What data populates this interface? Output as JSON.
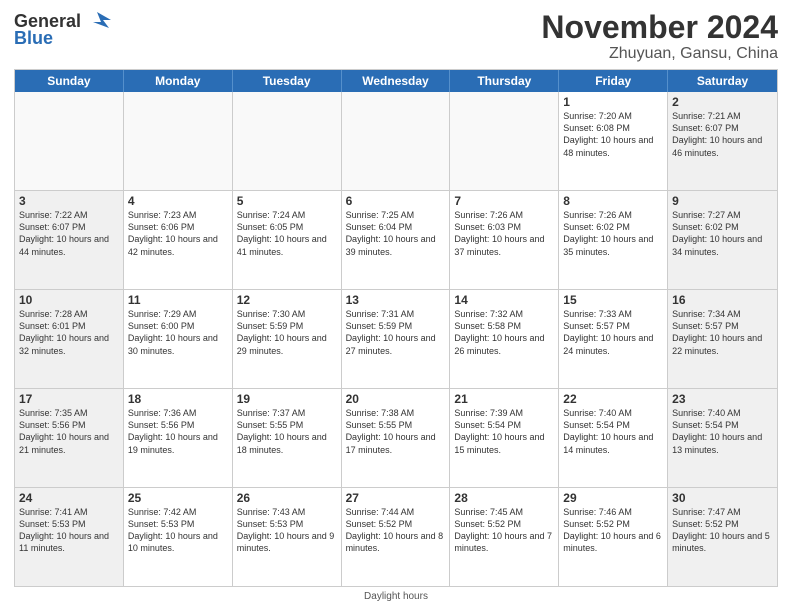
{
  "header": {
    "logo_general": "General",
    "logo_blue": "Blue",
    "month_title": "November 2024",
    "location": "Zhuyuan, Gansu, China"
  },
  "weekdays": [
    "Sunday",
    "Monday",
    "Tuesday",
    "Wednesday",
    "Thursday",
    "Friday",
    "Saturday"
  ],
  "footer": "Daylight hours",
  "weeks": [
    [
      {
        "day": "",
        "info": "",
        "empty": true
      },
      {
        "day": "",
        "info": "",
        "empty": true
      },
      {
        "day": "",
        "info": "",
        "empty": true
      },
      {
        "day": "",
        "info": "",
        "empty": true
      },
      {
        "day": "",
        "info": "",
        "empty": true
      },
      {
        "day": "1",
        "info": "Sunrise: 7:20 AM\nSunset: 6:08 PM\nDaylight: 10 hours\nand 48 minutes.",
        "empty": false
      },
      {
        "day": "2",
        "info": "Sunrise: 7:21 AM\nSunset: 6:07 PM\nDaylight: 10 hours\nand 46 minutes.",
        "empty": false,
        "shaded": true
      }
    ],
    [
      {
        "day": "3",
        "info": "Sunrise: 7:22 AM\nSunset: 6:07 PM\nDaylight: 10 hours\nand 44 minutes.",
        "empty": false,
        "shaded": true
      },
      {
        "day": "4",
        "info": "Sunrise: 7:23 AM\nSunset: 6:06 PM\nDaylight: 10 hours\nand 42 minutes.",
        "empty": false
      },
      {
        "day": "5",
        "info": "Sunrise: 7:24 AM\nSunset: 6:05 PM\nDaylight: 10 hours\nand 41 minutes.",
        "empty": false
      },
      {
        "day": "6",
        "info": "Sunrise: 7:25 AM\nSunset: 6:04 PM\nDaylight: 10 hours\nand 39 minutes.",
        "empty": false
      },
      {
        "day": "7",
        "info": "Sunrise: 7:26 AM\nSunset: 6:03 PM\nDaylight: 10 hours\nand 37 minutes.",
        "empty": false
      },
      {
        "day": "8",
        "info": "Sunrise: 7:26 AM\nSunset: 6:02 PM\nDaylight: 10 hours\nand 35 minutes.",
        "empty": false
      },
      {
        "day": "9",
        "info": "Sunrise: 7:27 AM\nSunset: 6:02 PM\nDaylight: 10 hours\nand 34 minutes.",
        "empty": false,
        "shaded": true
      }
    ],
    [
      {
        "day": "10",
        "info": "Sunrise: 7:28 AM\nSunset: 6:01 PM\nDaylight: 10 hours\nand 32 minutes.",
        "empty": false,
        "shaded": true
      },
      {
        "day": "11",
        "info": "Sunrise: 7:29 AM\nSunset: 6:00 PM\nDaylight: 10 hours\nand 30 minutes.",
        "empty": false
      },
      {
        "day": "12",
        "info": "Sunrise: 7:30 AM\nSunset: 5:59 PM\nDaylight: 10 hours\nand 29 minutes.",
        "empty": false
      },
      {
        "day": "13",
        "info": "Sunrise: 7:31 AM\nSunset: 5:59 PM\nDaylight: 10 hours\nand 27 minutes.",
        "empty": false
      },
      {
        "day": "14",
        "info": "Sunrise: 7:32 AM\nSunset: 5:58 PM\nDaylight: 10 hours\nand 26 minutes.",
        "empty": false
      },
      {
        "day": "15",
        "info": "Sunrise: 7:33 AM\nSunset: 5:57 PM\nDaylight: 10 hours\nand 24 minutes.",
        "empty": false
      },
      {
        "day": "16",
        "info": "Sunrise: 7:34 AM\nSunset: 5:57 PM\nDaylight: 10 hours\nand 22 minutes.",
        "empty": false,
        "shaded": true
      }
    ],
    [
      {
        "day": "17",
        "info": "Sunrise: 7:35 AM\nSunset: 5:56 PM\nDaylight: 10 hours\nand 21 minutes.",
        "empty": false,
        "shaded": true
      },
      {
        "day": "18",
        "info": "Sunrise: 7:36 AM\nSunset: 5:56 PM\nDaylight: 10 hours\nand 19 minutes.",
        "empty": false
      },
      {
        "day": "19",
        "info": "Sunrise: 7:37 AM\nSunset: 5:55 PM\nDaylight: 10 hours\nand 18 minutes.",
        "empty": false
      },
      {
        "day": "20",
        "info": "Sunrise: 7:38 AM\nSunset: 5:55 PM\nDaylight: 10 hours\nand 17 minutes.",
        "empty": false
      },
      {
        "day": "21",
        "info": "Sunrise: 7:39 AM\nSunset: 5:54 PM\nDaylight: 10 hours\nand 15 minutes.",
        "empty": false
      },
      {
        "day": "22",
        "info": "Sunrise: 7:40 AM\nSunset: 5:54 PM\nDaylight: 10 hours\nand 14 minutes.",
        "empty": false
      },
      {
        "day": "23",
        "info": "Sunrise: 7:40 AM\nSunset: 5:54 PM\nDaylight: 10 hours\nand 13 minutes.",
        "empty": false,
        "shaded": true
      }
    ],
    [
      {
        "day": "24",
        "info": "Sunrise: 7:41 AM\nSunset: 5:53 PM\nDaylight: 10 hours\nand 11 minutes.",
        "empty": false,
        "shaded": true
      },
      {
        "day": "25",
        "info": "Sunrise: 7:42 AM\nSunset: 5:53 PM\nDaylight: 10 hours\nand 10 minutes.",
        "empty": false
      },
      {
        "day": "26",
        "info": "Sunrise: 7:43 AM\nSunset: 5:53 PM\nDaylight: 10 hours\nand 9 minutes.",
        "empty": false
      },
      {
        "day": "27",
        "info": "Sunrise: 7:44 AM\nSunset: 5:52 PM\nDaylight: 10 hours\nand 8 minutes.",
        "empty": false
      },
      {
        "day": "28",
        "info": "Sunrise: 7:45 AM\nSunset: 5:52 PM\nDaylight: 10 hours\nand 7 minutes.",
        "empty": false
      },
      {
        "day": "29",
        "info": "Sunrise: 7:46 AM\nSunset: 5:52 PM\nDaylight: 10 hours\nand 6 minutes.",
        "empty": false
      },
      {
        "day": "30",
        "info": "Sunrise: 7:47 AM\nSunset: 5:52 PM\nDaylight: 10 hours\nand 5 minutes.",
        "empty": false,
        "shaded": true
      }
    ]
  ]
}
